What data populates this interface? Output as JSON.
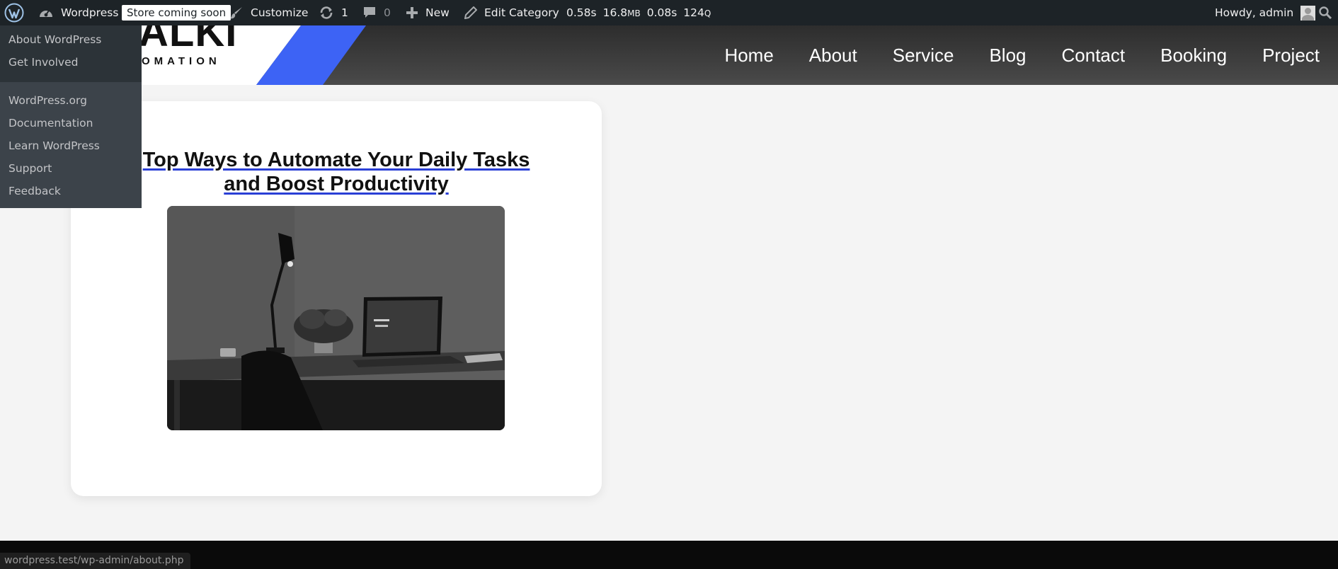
{
  "admin_bar": {
    "site_name": "Wordpress",
    "store_badge": "Store coming soon",
    "customize": "Customize",
    "updates_count": "1",
    "comments_count": "0",
    "new_label": "New",
    "edit_label": "Edit Category",
    "stats": {
      "time": "0.58s",
      "memory": "16.8",
      "memory_unit": "MB",
      "db_time": "0.08s",
      "queries": "124",
      "queries_unit": "Q"
    },
    "howdy": "Howdy, admin"
  },
  "wp_menu": {
    "group1": [
      "About WordPress",
      "Get Involved"
    ],
    "group2": [
      "WordPress.org",
      "Documentation",
      "Learn WordPress",
      "Support",
      "Feedback"
    ]
  },
  "site": {
    "logo_text": "ALKI",
    "logo_sub": "OMATION",
    "nav": [
      "Home",
      "About",
      "Service",
      "Blog",
      "Contact",
      "Booking",
      "Project"
    ]
  },
  "post": {
    "title": "Top Ways to Automate Your Daily Tasks and Boost Productivity"
  },
  "status_url": "wordpress.test/wp-admin/about.php",
  "colors": {
    "admin_bar": "#1d2327",
    "accent_blue": "#3d63f5",
    "link_underline": "#2a3fd6"
  }
}
